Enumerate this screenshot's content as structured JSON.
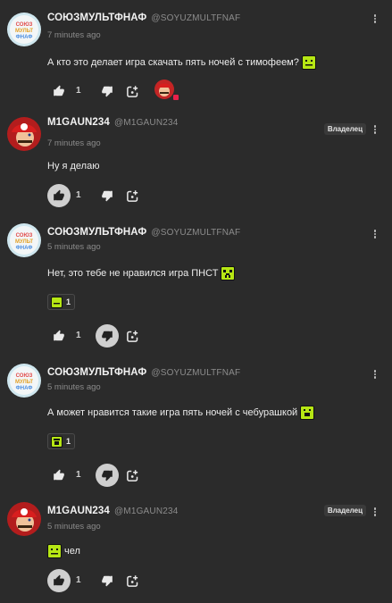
{
  "comments": [
    {
      "author": "СОЮЗМУЛЬТФНАФ",
      "handle": "@SOYUZMULTFNAF",
      "time": "7 minutes ago",
      "text": "А кто это делает игра скачать пять ночей с тимофеем?",
      "likes": "1",
      "owner": ""
    },
    {
      "author": "M1GAUN234",
      "handle": "@M1GAUN234",
      "time": "7 minutes ago",
      "text": "Ну я делаю",
      "likes": "1",
      "owner": "Владелец"
    },
    {
      "author": "СОЮЗМУЛЬТФНАФ",
      "handle": "@SOYUZMULTFNAF",
      "time": "5 minutes ago",
      "text": "Нет, это тебе не нравился игра ПНСТ",
      "reaction_count": "1",
      "likes": "1",
      "owner": ""
    },
    {
      "author": "СОЮЗМУЛЬТФНАФ",
      "handle": "@SOYUZMULTFNAF",
      "time": "5 minutes ago",
      "text": "А может нравится такие игра пять ночей с чебурашкой",
      "reaction_count": "1",
      "likes": "1",
      "owner": ""
    },
    {
      "author": "M1GAUN234",
      "handle": "@M1GAUN234",
      "time": "5 minutes ago",
      "text": "чел",
      "likes": "1",
      "owner": "Владелец"
    }
  ],
  "avatar_logo_text": "СОЮЗ МУЛЬТ ФНАФ",
  "colors": {
    "background": "#2b2b2b",
    "emoji": "#b6e614",
    "active_button": "#cfcfcf",
    "notification_dot": "#e8214a"
  },
  "icons": [
    "thumbs-up-icon",
    "thumbs-down-icon",
    "reply-icon",
    "more-vertical-icon",
    "emoji-icon"
  ]
}
